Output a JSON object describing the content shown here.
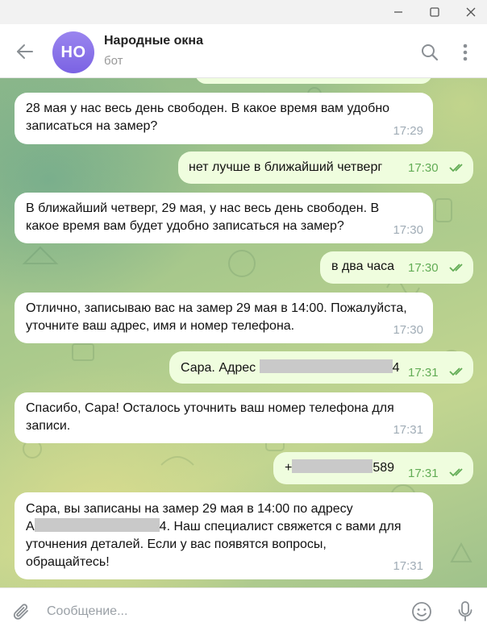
{
  "window": {
    "minimize_icon": "minimize-icon",
    "maximize_icon": "maximize-icon",
    "close_icon": "close-icon"
  },
  "header": {
    "avatar_initials": "НО",
    "title": "Народные окна",
    "status": "бот",
    "avatar_color": "#8b74ea"
  },
  "messages": [
    {
      "direction": "in",
      "text": "28 мая у нас весь день свободен. В какое время вам удобно записаться на замер?",
      "time": "17:29"
    },
    {
      "direction": "out",
      "text": "нет лучше в ближайший четверг",
      "time": "17:30",
      "read": true
    },
    {
      "direction": "in",
      "text": "В ближайший четверг, 29 мая, у нас весь день свободен. В какое время вам будет удобно записаться на замер?",
      "time": "17:30"
    },
    {
      "direction": "out",
      "text": "в два часа",
      "time": "17:30",
      "read": true
    },
    {
      "direction": "in",
      "text": "Отлично, записываю вас на замер 29 мая в 14:00. Пожалуйста, уточните ваш адрес, имя и номер телефона.",
      "time": "17:30"
    },
    {
      "direction": "out",
      "text_prefix": "Сара. Адрес ",
      "text_suffix": "4",
      "redacted": true,
      "time": "17:31",
      "read": true
    },
    {
      "direction": "in",
      "text": "Спасибо, Сара! Осталось уточнить ваш номер телефона для записи.",
      "time": "17:31"
    },
    {
      "direction": "out",
      "text_prefix": "+",
      "text_suffix": "589",
      "redacted": true,
      "time": "17:31",
      "read": true
    },
    {
      "direction": "in",
      "line1": "Сара, вы записаны на замер 29 мая в 14:00 по адресу",
      "line2_prefix": "А",
      "line2_suffix": "4. Наш специалист свяжется с вами для",
      "line3": "уточнения деталей. Если у вас появятся вопросы,",
      "line4": "обращайтесь!",
      "redacted": true,
      "time": "17:31"
    }
  ],
  "composer": {
    "placeholder": "Сообщение..."
  },
  "colors": {
    "incoming_bubble": "#ffffff",
    "outgoing_bubble": "#effdde",
    "outgoing_time": "#62ac55",
    "incoming_time": "#a0acb6"
  }
}
